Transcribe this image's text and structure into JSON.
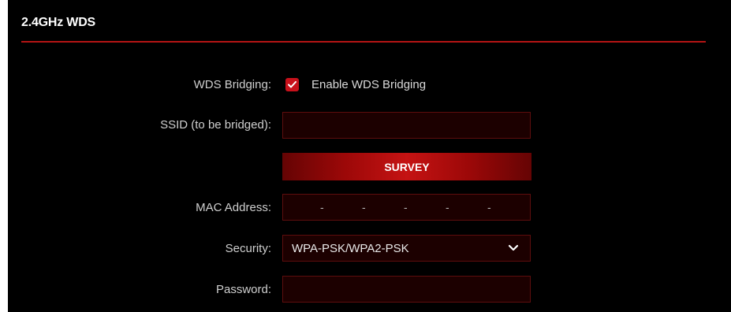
{
  "section": {
    "title": "2.4GHz WDS"
  },
  "wds_bridging": {
    "label": "WDS Bridging:",
    "checkbox_label": "Enable WDS Bridging",
    "checked": true
  },
  "ssid": {
    "label": "SSID (to be bridged):",
    "value": ""
  },
  "survey_button": {
    "label": "SURVEY"
  },
  "mac_address": {
    "label": "MAC Address:",
    "separators": [
      "-",
      "-",
      "-",
      "-",
      "-"
    ],
    "value": ""
  },
  "security": {
    "label": "Security:",
    "selected": "WPA-PSK/WPA2-PSK",
    "icon": "chevron-down-icon"
  },
  "password": {
    "label": "Password:",
    "value": ""
  },
  "colors": {
    "background": "#000000",
    "accent": "#c8111b",
    "field_background": "#1c0000",
    "field_border": "#5e0d0d",
    "label_text": "#cfcfcf"
  }
}
